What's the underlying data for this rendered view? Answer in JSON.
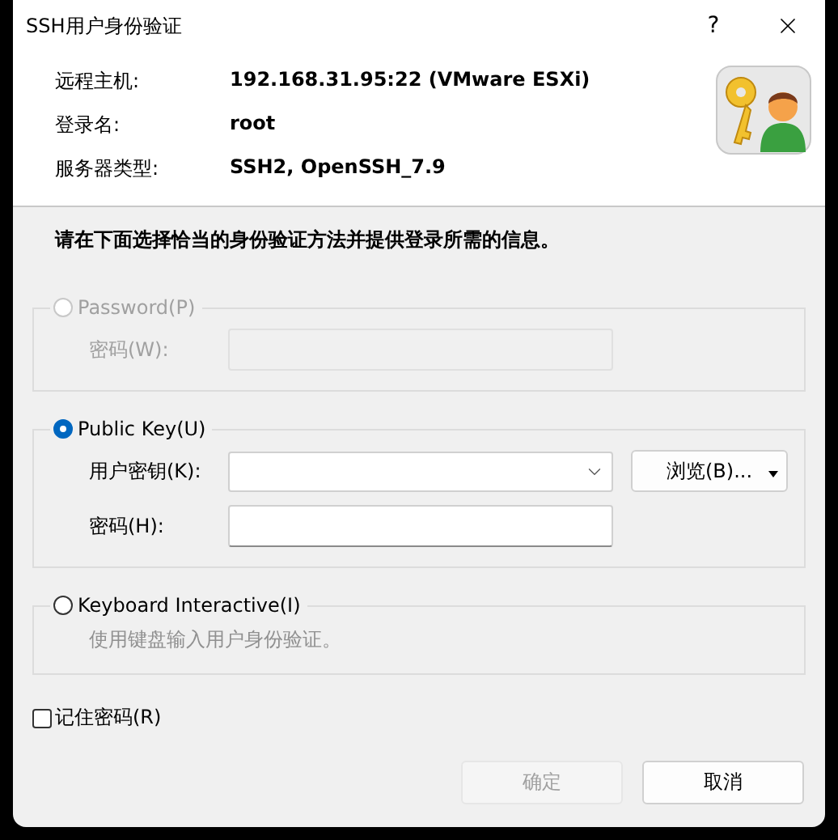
{
  "window": {
    "title": "SSH用户身份验证",
    "help": "?"
  },
  "host_info": [
    {
      "label": "远程主机:",
      "value": "192.168.31.95:22 (VMware ESXi)"
    },
    {
      "label": "登录名:",
      "value": "root"
    },
    {
      "label": "服务器类型:",
      "value": "SSH2, OpenSSH_7.9"
    }
  ],
  "instruction": "请在下面选择恰当的身份验证方法并提供登录所需的信息。",
  "methods": [
    {
      "label": "Password(P)",
      "selected": false,
      "disabled": true,
      "fields": [
        {
          "kind": "text",
          "label": "密码(W):"
        }
      ]
    },
    {
      "label": "Public Key(U)",
      "selected": true,
      "disabled": false,
      "fields": [
        {
          "kind": "combo",
          "label": "用户密钥(K):"
        },
        {
          "kind": "text",
          "label": "密码(H):"
        }
      ],
      "browse_button": "浏览(B)..."
    },
    {
      "label": "Keyboard Interactive(I)",
      "selected": false,
      "disabled": false,
      "description": "使用键盘输入用户身份验证。"
    }
  ],
  "remember": {
    "label": "记住密码(R)",
    "checked": false
  },
  "buttons": [
    {
      "label": "确定",
      "disabled": true
    },
    {
      "label": "取消",
      "disabled": false
    }
  ]
}
